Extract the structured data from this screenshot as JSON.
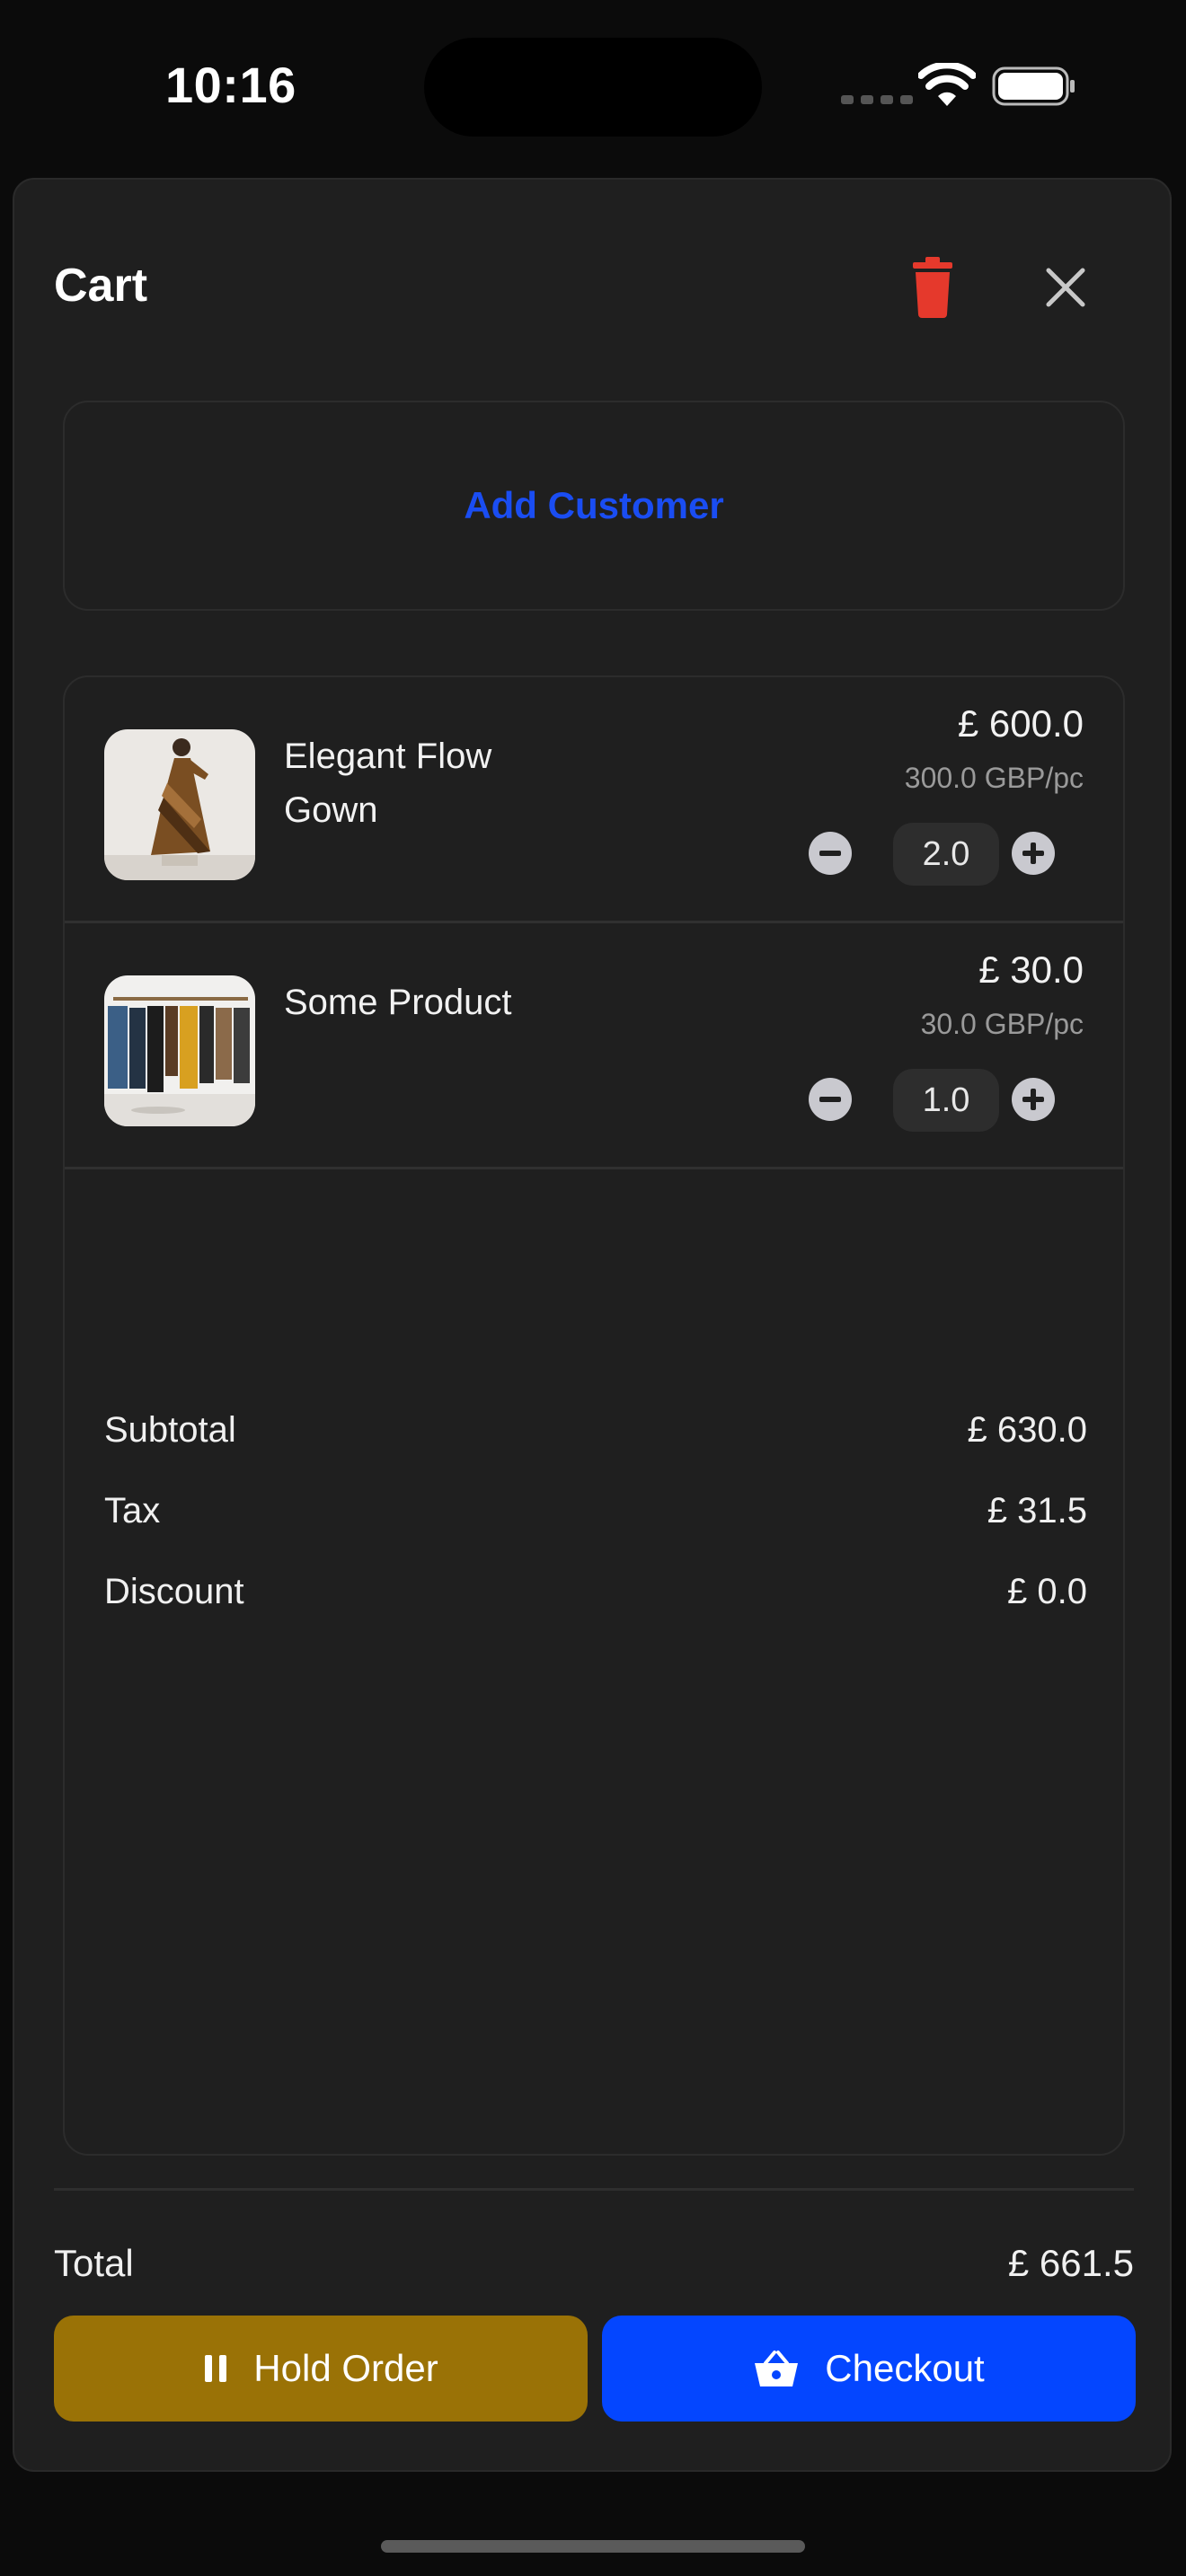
{
  "status_bar": {
    "time": "10:16"
  },
  "header": {
    "title": "Cart"
  },
  "customer": {
    "add_label": "Add Customer"
  },
  "items": [
    {
      "name": "Elegant Flow Gown",
      "price": "£ 600.0",
      "unit_price": "300.0 GBP/pc",
      "quantity": "2.0"
    },
    {
      "name": "Some Product",
      "price": "£ 30.0",
      "unit_price": "30.0 GBP/pc",
      "quantity": "1.0"
    }
  ],
  "summary": {
    "subtotal_label": "Subtotal",
    "subtotal_value": "£ 630.0",
    "tax_label": "Tax",
    "tax_value": "£ 31.5",
    "discount_label": "Discount",
    "discount_value": "£ 0.0"
  },
  "total": {
    "label": "Total",
    "value": "£ 661.5"
  },
  "actions": {
    "hold_label": "Hold Order",
    "checkout_label": "Checkout"
  },
  "colors": {
    "accent": "#0446ff",
    "hold": "#9a7206",
    "danger": "#e5392c",
    "link": "#1a4df2"
  },
  "icons": [
    "trash-icon",
    "close-icon",
    "minus-icon",
    "plus-icon",
    "pause-icon",
    "basket-icon",
    "wifi-icon",
    "battery-icon"
  ]
}
